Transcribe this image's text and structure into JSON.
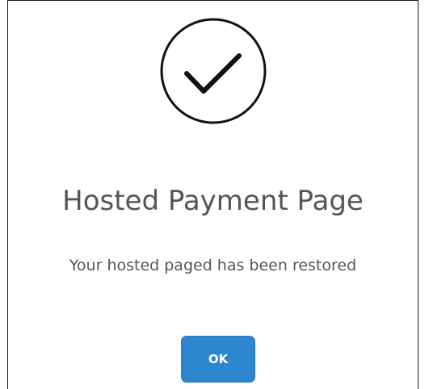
{
  "dialog": {
    "icon": "checkmark-circle-icon",
    "title": "Hosted Payment Page",
    "message": "Your hosted paged has been restored",
    "ok_label": "OK"
  },
  "colors": {
    "title_text": "#555555",
    "button_bg": "#2e86cf",
    "button_text": "#ffffff",
    "icon_stroke": "#111111"
  }
}
